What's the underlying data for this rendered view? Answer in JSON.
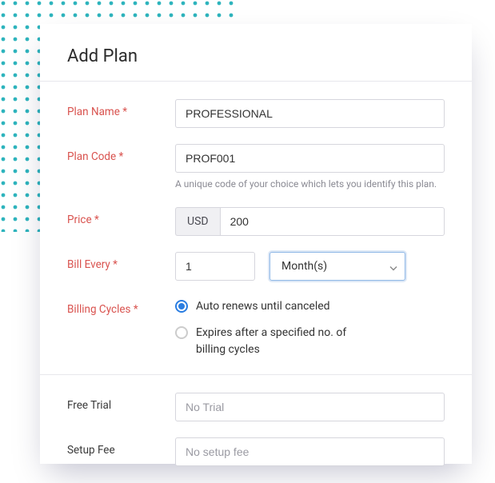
{
  "title": "Add Plan",
  "fields": {
    "plan_name": {
      "label": "Plan Name *",
      "value": "PROFESSIONAL"
    },
    "plan_code": {
      "label": "Plan Code *",
      "value": "PROF001",
      "helper": "A unique code of your choice which lets you identify this plan."
    },
    "price": {
      "label": "Price *",
      "currency": "USD",
      "value": "200"
    },
    "bill_every": {
      "label": "Bill Every *",
      "value": "1",
      "unit": "Month(s)"
    },
    "billing_cycles": {
      "label": "Billing Cycles *",
      "options": {
        "auto_renew": "Auto renews until canceled",
        "expires": "Expires after a specified no. of billing cycles"
      },
      "selected": "auto_renew"
    },
    "free_trial": {
      "label": "Free Trial",
      "placeholder": "No Trial"
    },
    "setup_fee": {
      "label": "Setup Fee",
      "placeholder": "No setup fee"
    }
  }
}
